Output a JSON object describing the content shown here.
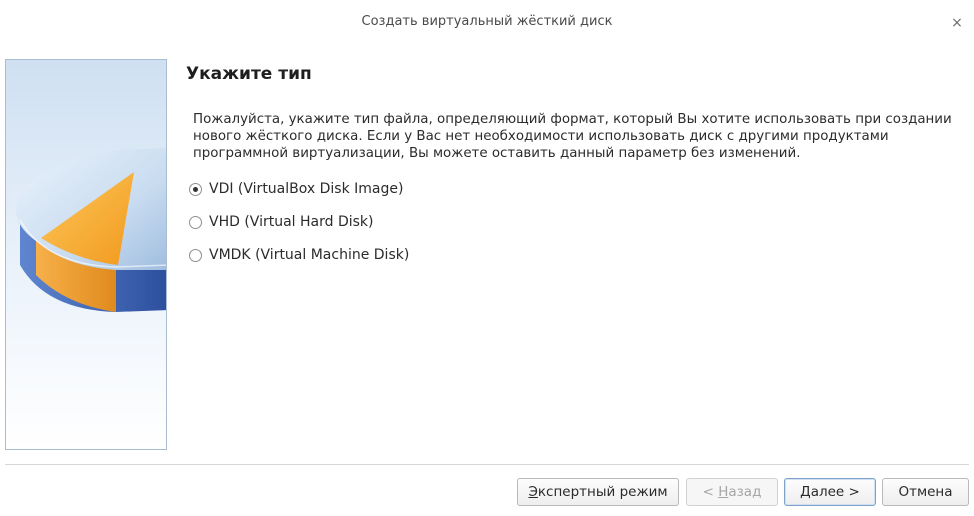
{
  "window": {
    "title": "Создать виртуальный жёсткий диск",
    "close_symbol": "×"
  },
  "page": {
    "heading": "Укажите тип",
    "description": "Пожалуйста, укажите тип файла, определяющий формат, который Вы хотите использовать при создании нового жёсткого диска. Если у Вас нет необходимости использовать диск с другими продуктами программной виртуализации, Вы можете оставить данный параметр без изменений."
  },
  "disk_types": [
    {
      "label": "VDI (VirtualBox Disk Image)",
      "selected": true
    },
    {
      "label": "VHD (Virtual Hard Disk)",
      "selected": false
    },
    {
      "label": "VMDK (Virtual Machine Disk)",
      "selected": false
    }
  ],
  "buttons": {
    "expert": {
      "mnemonic": "Э",
      "rest": "кспертный режим"
    },
    "back": {
      "prefix": "< ",
      "mnemonic": "Н",
      "rest": "азад",
      "enabled": false
    },
    "next": {
      "mnemonic": "Д",
      "rest": "алее >"
    },
    "cancel": "Отмена"
  },
  "colors": {
    "pie_top": "#c4daf0",
    "pie_slice": "#f5a623",
    "pie_side_blue": "#3a63b8",
    "pie_side_orange": "#f0a033"
  }
}
